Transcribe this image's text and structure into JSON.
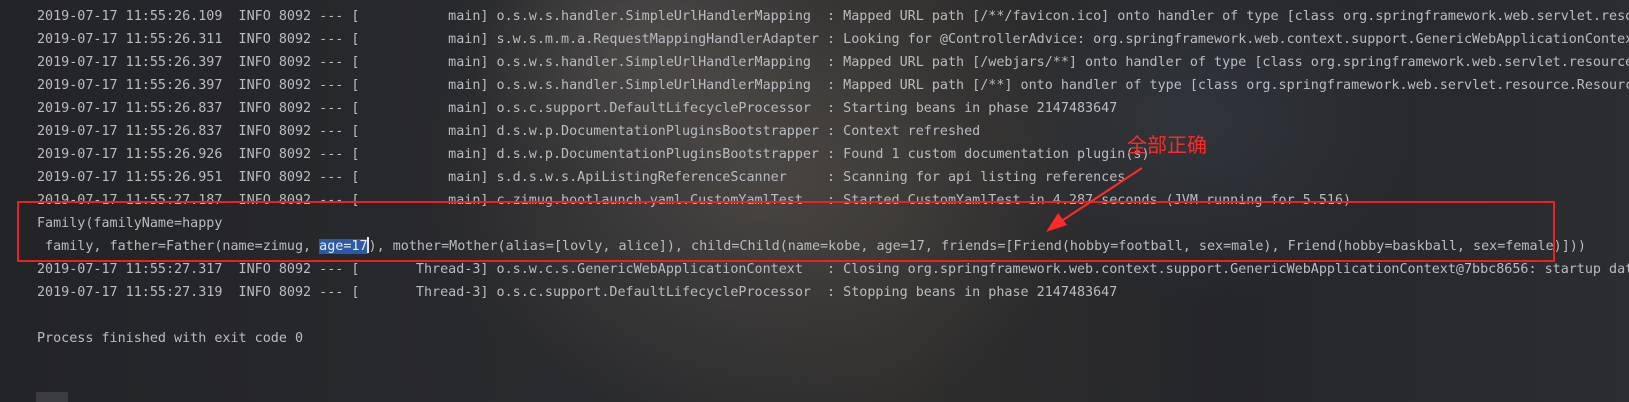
{
  "console": {
    "lines": [
      "2019-07-17 11:55:26.109  INFO 8092 --- [           main] o.s.w.s.handler.SimpleUrlHandlerMapping  : Mapped URL path [/**/favicon.ico] onto handler of type [class org.springframework.web.servlet.resou",
      "2019-07-17 11:55:26.311  INFO 8092 --- [           main] s.w.s.m.m.a.RequestMappingHandlerAdapter : Looking for @ControllerAdvice: org.springframework.web.context.support.GenericWebApplicationContext",
      "2019-07-17 11:55:26.397  INFO 8092 --- [           main] o.s.w.s.handler.SimpleUrlHandlerMapping  : Mapped URL path [/webjars/**] onto handler of type [class org.springframework.web.servlet.resource.",
      "2019-07-17 11:55:26.397  INFO 8092 --- [           main] o.s.w.s.handler.SimpleUrlHandlerMapping  : Mapped URL path [/**] onto handler of type [class org.springframework.web.servlet.resource.Resource",
      "2019-07-17 11:55:26.837  INFO 8092 --- [           main] o.s.c.support.DefaultLifecycleProcessor  : Starting beans in phase 2147483647",
      "2019-07-17 11:55:26.837  INFO 8092 --- [           main] d.s.w.p.DocumentationPluginsBootstrapper : Context refreshed",
      "2019-07-17 11:55:26.926  INFO 8092 --- [           main] d.s.w.p.DocumentationPluginsBootstrapper : Found 1 custom documentation plugin(s)",
      "2019-07-17 11:55:26.951  INFO 8092 --- [           main] s.d.s.w.s.ApiListingReferenceScanner     : Scanning for api listing references",
      "2019-07-17 11:55:27.187  INFO 8092 --- [           main] c.zimug.bootlaunch.yaml.CustomYamlTest   : Started CustomYamlTest in 4.287 seconds (JVM running for 5.516)",
      "Family(familyName=happy",
      "2019-07-17 11:55:27.317  INFO 8092 --- [       Thread-3] o.s.w.c.s.GenericWebApplicationContext   : Closing org.springframework.web.context.support.GenericWebApplicationContext@7bbc8656: startup date",
      "2019-07-17 11:55:27.319  INFO 8092 --- [       Thread-3] o.s.c.support.DefaultLifecycleProcessor  : Stopping beans in phase 2147483647"
    ],
    "family_line": {
      "before": " family, father=Father(name=zimug, ",
      "selected": "age=17",
      "after": "), mother=Mother(alias=[lovly, alice]), child=Child(name=kobe, age=17, friends=[Friend(hobby=football, sex=male), Friend(hobby=baskball, sex=female)]))"
    },
    "process_exit": "Process finished with exit code 0"
  },
  "annotation": {
    "text": "全部正确",
    "color": "#ff2a26"
  },
  "colors": {
    "log_text": "#b9bcc1",
    "selection": "#2d5aa6",
    "highlight_box": "#e8231f"
  }
}
